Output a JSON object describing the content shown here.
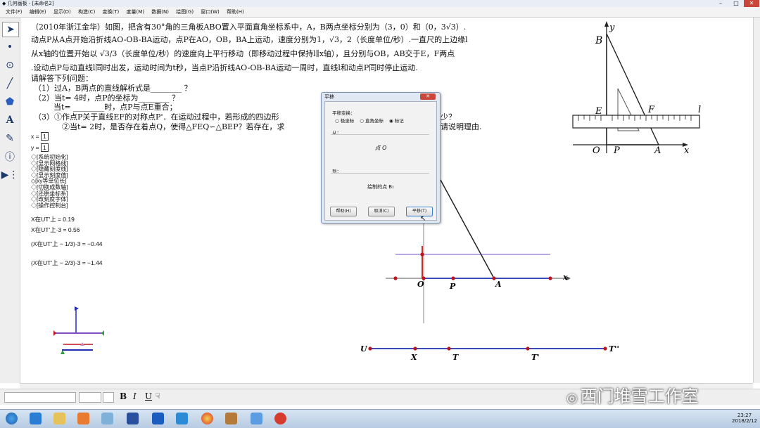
{
  "window": {
    "title": "几何画板 - [未命名2]"
  },
  "menu": [
    "文件(F)",
    "编辑(E)",
    "显示(D)",
    "构造(C)",
    "变换(T)",
    "度量(M)",
    "数据(N)",
    "绘图(G)",
    "窗口(W)",
    "帮助(H)"
  ],
  "problem": {
    "line1": "（2010年浙江金华）如图，把含有30°角的三角板ABO置入平面直角坐标系中，A，B两点坐标分别为（3，0）和（0，3√3）.",
    "line2": "动点P从A点开始沿折线AO-OB-BA运动，点P在AO，OB，BA上运动，速度分别为1，√3，2（长度单位/秒）.一直尺的上边缘l",
    "line3": "从x轴的位置开始以 √3/3（长度单位/秒）的速度向上平行移动（即移动过程中保持l∥x轴），且分别与OB，AB交于E，F两点",
    "line4": ".设动点P与动直线l同时出发，运动时间为t秒，当点P沿折线AO-OB-BA运动一周时，直线l和动点P同时停止运动.",
    "line5": "请解答下列问题：",
    "q1": "（1）过A，B两点的直线解析式是________ ？",
    "q2a": "（2）当t= 4时，点P的坐标为________ ？",
    "q2b": "当t= ________时，点P与点E重合；",
    "q3a": "（3）①作点P关于直线EF的对称点P'．在运动过程中，若形成的四边形",
    "q3a_end": "少？",
    "q3b": "②当t= 2时，是否存在着点Q，使得△FEQ∽△BEP？若存在，求",
    "q3b_end": "请说明理由."
  },
  "params": {
    "x_label": "x =",
    "x_value": "1",
    "y_label": "y =",
    "y_value": "1"
  },
  "action_buttons": [
    "系统初始化",
    "显示网格线",
    "隐藏刻度线",
    "显示刻度值",
    "xy等单位长",
    "切换成数轴",
    "还原坐标系",
    "改刻度字体",
    "操作控制台"
  ],
  "measurements": [
    {
      "label": "X在UT'上 = 0.19"
    },
    {
      "label": "X在UT'上·3 = 0.56"
    },
    {
      "label": "(X在UT'上 − 1/3)·3 = −0.44"
    },
    {
      "label": "(X在UT'上 − 2/3)·3 = −1.44"
    }
  ],
  "dialog": {
    "title": "平移",
    "transform_label": "平移变换：",
    "options": [
      "极坐标",
      "直角坐标",
      "标记"
    ],
    "selected_option": "标记",
    "from_label": "从：",
    "from_value": "点 O",
    "to_label": "到：",
    "to_value": "绘制的点 B₁",
    "buttons": {
      "help": "帮助(H)",
      "cancel": "取消(C)",
      "ok": "平移(T)"
    }
  },
  "figure_labels": {
    "B": "B",
    "y": "y",
    "E": "E",
    "F": "F",
    "l": "l",
    "O": "O",
    "P": "P",
    "A": "A",
    "x": "x"
  },
  "sketch_labels": {
    "O": "O",
    "P": "P",
    "A": "A",
    "x": "x"
  },
  "slider_labels": {
    "U": "U",
    "X": "X",
    "T": "T",
    "T1": "T'",
    "T2": "T''"
  },
  "format_bar": {
    "bold": "B",
    "italic": "I",
    "underline": "U"
  },
  "watermark": "西门堆雪工作室",
  "clock": {
    "time": "23:27",
    "date": "2018/2/12"
  },
  "colors": {
    "accent_red": "#c0141b",
    "line_blue": "#1f2fb4",
    "line_purple": "#7a4fc8",
    "dialog_bg": "#dfe8f3"
  }
}
